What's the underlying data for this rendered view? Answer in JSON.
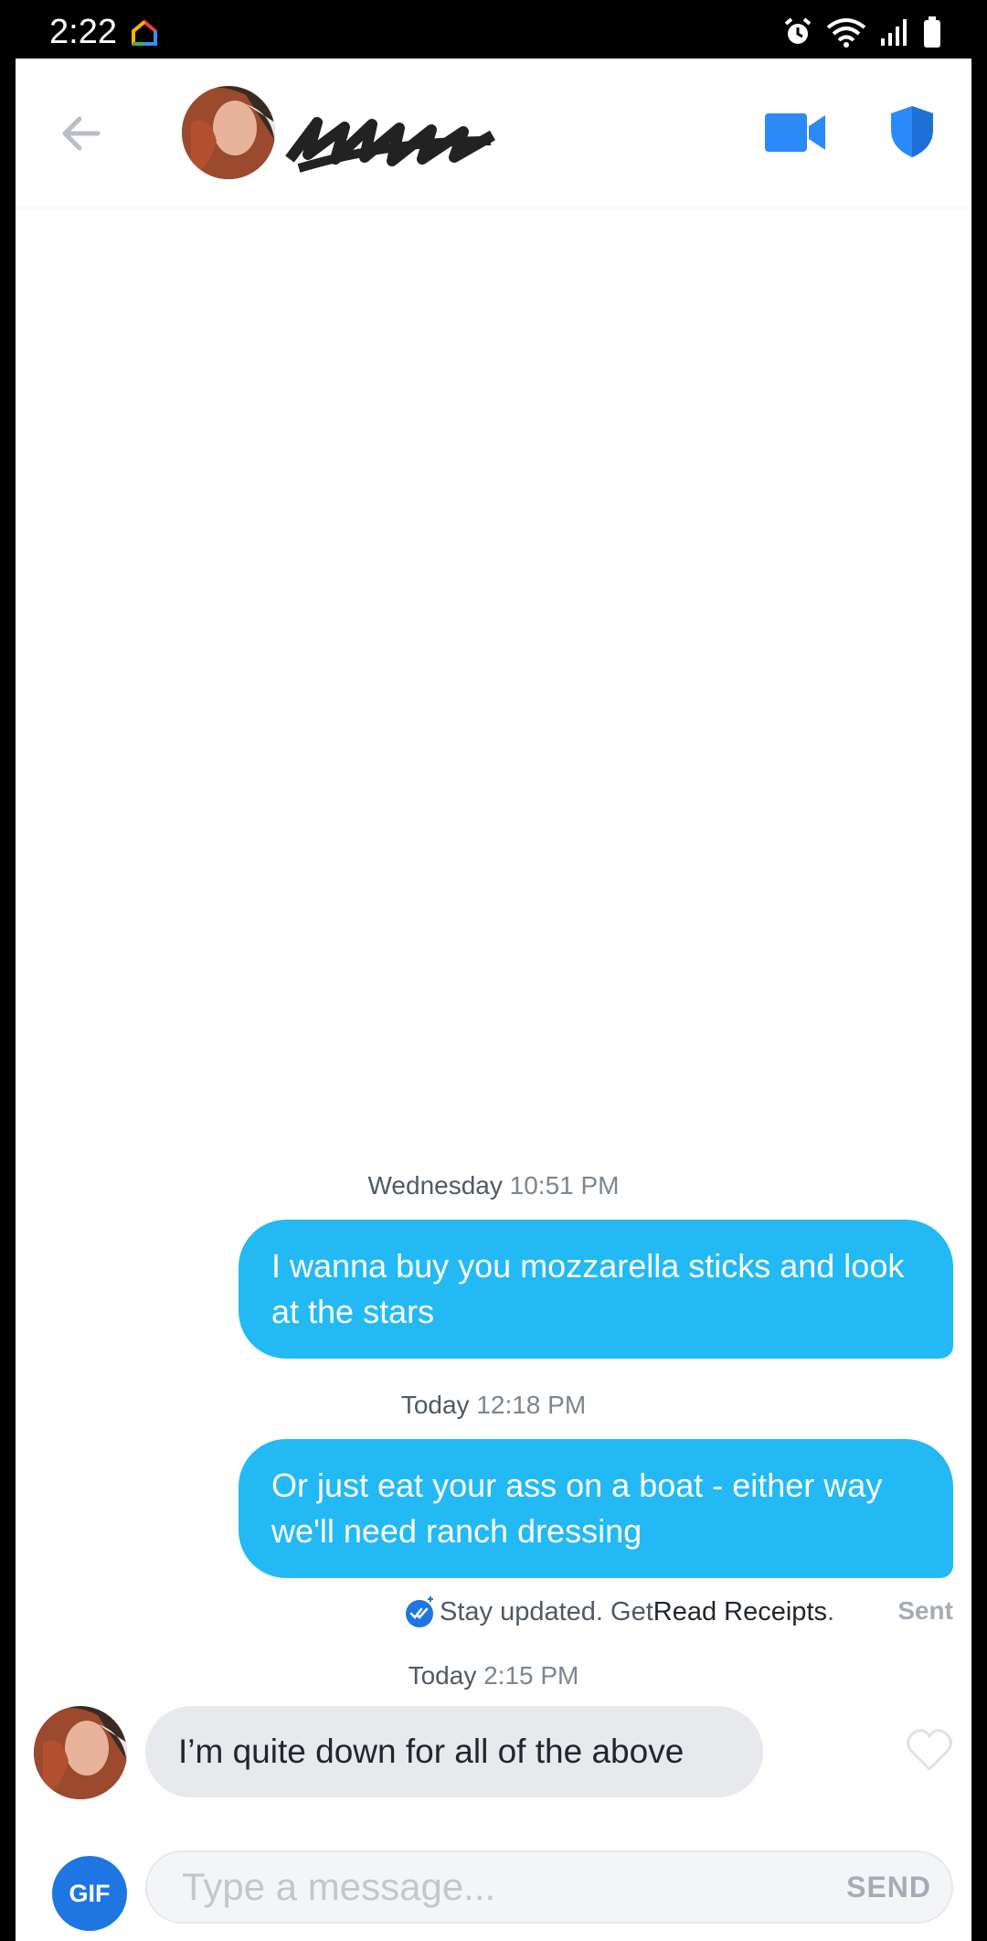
{
  "status_bar": {
    "time": "2:22",
    "icons": [
      "home-icon",
      "alarm-icon",
      "wifi-icon",
      "signal-icon",
      "battery-icon"
    ]
  },
  "header": {
    "back_icon": "arrow-left-icon",
    "video_icon": "video-camera-icon",
    "safety_icon": "shield-icon",
    "name_redacted": true
  },
  "messages": [
    {
      "timestamp_day": "Wednesday",
      "timestamp_time": "10:51 PM",
      "direction": "outgoing",
      "text": "I wanna buy you mozzarella sticks and look at the stars"
    },
    {
      "timestamp_day": "Today",
      "timestamp_time": "12:18 PM",
      "direction": "outgoing",
      "text": "Or just eat your ass on a boat - either way we'll need ranch dressing"
    },
    {
      "timestamp_day": "Today",
      "timestamp_time": "2:15 PM",
      "direction": "incoming",
      "text": "I’m quite down for all of the above"
    }
  ],
  "receipt": {
    "prefix": "Stay updated. Get ",
    "link": "Read Receipts",
    "suffix": ".",
    "status": "Sent"
  },
  "composer": {
    "gif_label": "GIF",
    "placeholder": "Type a message...",
    "send_label": "SEND"
  },
  "colors": {
    "outgoing_bubble": "#23b9f5",
    "incoming_bubble": "#e8e9ec",
    "accent_blue": "#1e76e3",
    "icon_blue": "#2b8af7"
  }
}
